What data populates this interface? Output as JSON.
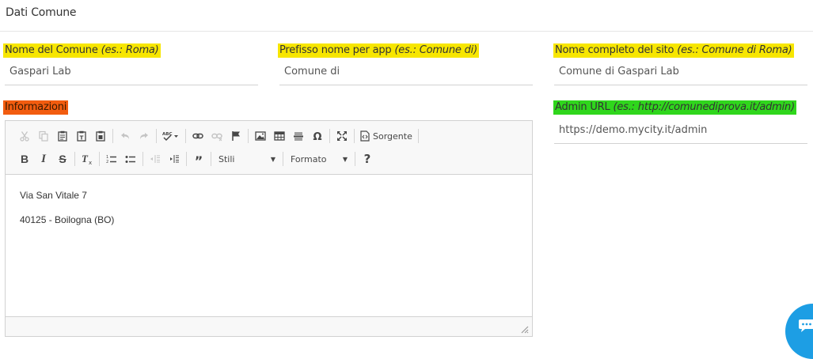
{
  "header": {
    "title": "Dati Comune"
  },
  "fields": {
    "nome_comune": {
      "label": "Nome del Comune",
      "hint": "(es.: Roma)",
      "value": "Gaspari Lab"
    },
    "prefisso": {
      "label": "Prefisso nome per app",
      "hint": "(es.: Comune di)",
      "value": "Comune di"
    },
    "nome_sito": {
      "label": "Nome completo del sito",
      "hint": "(es.: Comune di Roma)",
      "value": "Comune di Gaspari Lab"
    },
    "informazioni": {
      "label": "Informazioni"
    },
    "admin_url": {
      "label": "Admin URL",
      "hint": "(es.: http://comunediprova.it/admin)",
      "value": "https://demo.mycity.it/admin"
    }
  },
  "highlight_colors": {
    "yellow": "#f7e600",
    "orange": "#f25c0f",
    "green": "#2fd61c"
  },
  "editor": {
    "toolbar": {
      "source_label": "Sorgente",
      "styles_label": "Stili",
      "format_label": "Formato",
      "help_label": "?"
    },
    "content": [
      "Via San Vitale 7",
      "40125 - Boilogna (BO)"
    ]
  },
  "chat": {
    "icon": "chat-icon",
    "color": "#1d9ee4"
  }
}
